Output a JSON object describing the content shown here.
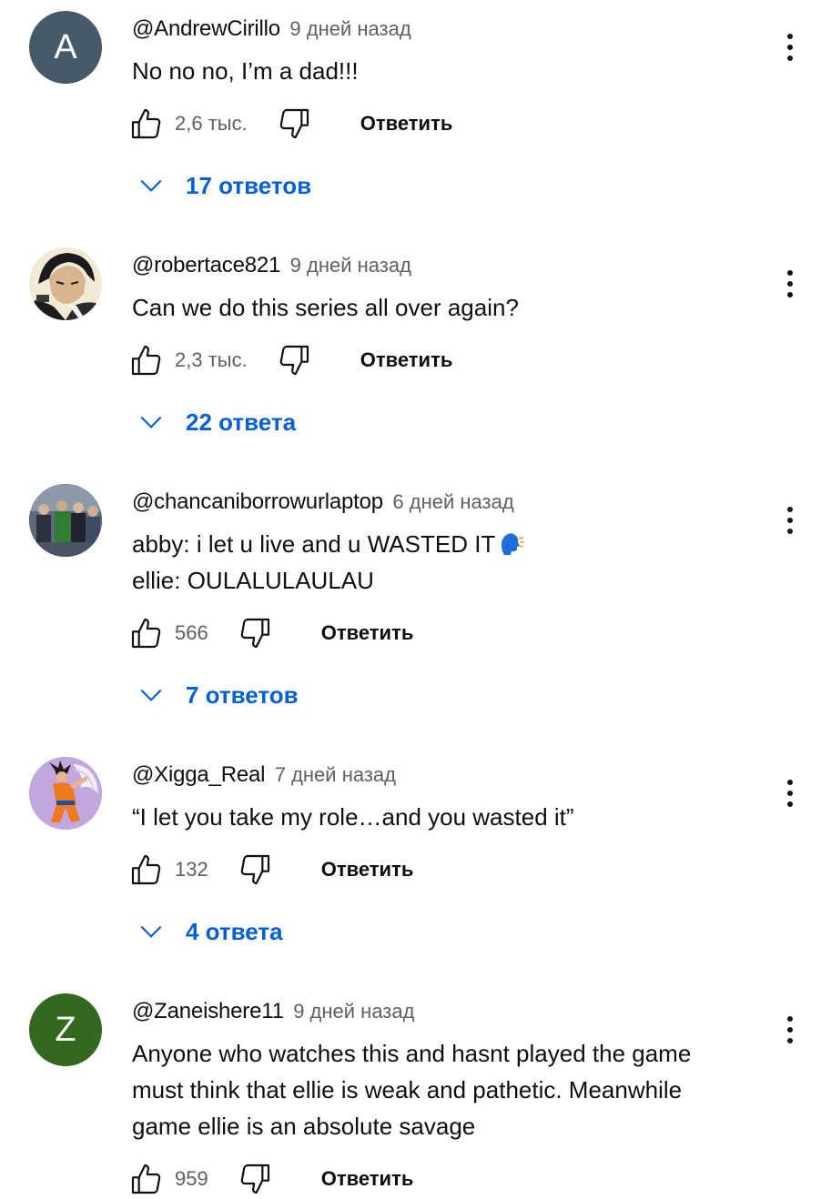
{
  "ui": {
    "reply_label": "Ответить",
    "accent_color": "#065fd4",
    "meta_color": "#606060"
  },
  "comments": [
    {
      "author": "@AndrewCirillo",
      "time": "9 дней назад",
      "avatar": {
        "type": "letter",
        "letter": "A",
        "color": "#465a69"
      },
      "lines": [
        "No no no, I’m a dad!!!"
      ],
      "likes": "2,6 тыс.",
      "replies": "17 ответов"
    },
    {
      "author": "@robertace821",
      "time": "9 дней назад",
      "avatar": {
        "type": "image",
        "icon": "anime-character-avatar"
      },
      "lines": [
        "Can we do this series all over again?"
      ],
      "likes": "2,3 тыс.",
      "replies": "22 ответа"
    },
    {
      "author": "@chancaniborrowurlaptop",
      "time": "6 дней назад",
      "avatar": {
        "type": "image",
        "icon": "group-photo-avatar"
      },
      "lines": [
        "abby: i let u live and u WASTED IT",
        "ellie: OULALULAULAU"
      ],
      "emoji": "speaking-head-emoji",
      "likes": "566",
      "replies": "7 ответов"
    },
    {
      "author": "@Xigga_Real",
      "time": "7 дней назад",
      "avatar": {
        "type": "image",
        "icon": "goku-angel-avatar"
      },
      "lines": [
        "“I let you take my role…and you wasted it”"
      ],
      "likes": "132",
      "replies": "4 ответа"
    },
    {
      "author": "@Zaneishere11",
      "time": "9 дней назад",
      "avatar": {
        "type": "letter",
        "letter": "Z",
        "color": "#33691e"
      },
      "lines": [
        "Anyone who watches this and hasnt played the game",
        "must think that ellie is weak and pathetic. Meanwhile",
        "game ellie is an absolute savage"
      ],
      "likes": "959",
      "replies": ""
    }
  ]
}
